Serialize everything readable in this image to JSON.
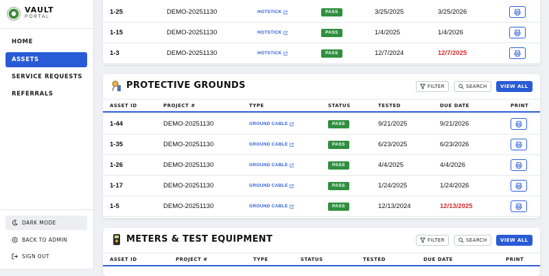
{
  "brand": {
    "title": "VAULT",
    "subtitle": "PORTAL"
  },
  "nav": {
    "items": [
      "HOME",
      "ASSETS",
      "SERVICE REQUESTS",
      "REFERRALS"
    ],
    "active": 1
  },
  "bottom": {
    "dark_mode": "DARK MODE",
    "back": "BACK TO ADMIN",
    "signout": "SIGN OUT"
  },
  "buttons": {
    "filter": "FILTER",
    "search": "SEARCH",
    "view_all": "VIEW ALL"
  },
  "hotsticks": {
    "rows": [
      {
        "id": "1-25",
        "project": "DEMO-20251130",
        "type": "HOTSTICK",
        "status": "PASS",
        "tested": "3/25/2025",
        "due": "3/25/2026",
        "overdue": false
      },
      {
        "id": "1-15",
        "project": "DEMO-20251130",
        "type": "HOTSTICK",
        "status": "PASS",
        "tested": "1/4/2025",
        "due": "1/4/2026",
        "overdue": false
      },
      {
        "id": "1-3",
        "project": "DEMO-20251130",
        "type": "HOTSTICK",
        "status": "PASS",
        "tested": "12/7/2024",
        "due": "12/7/2025",
        "overdue": true
      }
    ]
  },
  "grounds": {
    "title": "PROTECTIVE GROUNDS",
    "columns": [
      "ASSET ID",
      "PROJECT #",
      "TYPE",
      "STATUS",
      "TESTED",
      "DUE DATE",
      "PRINT"
    ],
    "rows": [
      {
        "id": "1-44",
        "project": "DEMO-20251130",
        "type": "GROUND CABLE",
        "status": "PASS",
        "tested": "9/21/2025",
        "due": "9/21/2026",
        "overdue": false
      },
      {
        "id": "1-35",
        "project": "DEMO-20251130",
        "type": "GROUND CABLE",
        "status": "PASS",
        "tested": "6/23/2025",
        "due": "6/23/2026",
        "overdue": false
      },
      {
        "id": "1-26",
        "project": "DEMO-20251130",
        "type": "GROUND CABLE",
        "status": "PASS",
        "tested": "4/4/2025",
        "due": "4/4/2026",
        "overdue": false
      },
      {
        "id": "1-17",
        "project": "DEMO-20251130",
        "type": "GROUND CABLE",
        "status": "PASS",
        "tested": "1/24/2025",
        "due": "1/24/2026",
        "overdue": false
      },
      {
        "id": "1-5",
        "project": "DEMO-20251130",
        "type": "GROUND CABLE",
        "status": "PASS",
        "tested": "12/13/2024",
        "due": "12/13/2025",
        "overdue": true
      }
    ]
  },
  "meters": {
    "title": "METERS & TEST EQUIPMENT",
    "columns": [
      "ASSET ID",
      "PROJECT #",
      "TYPE",
      "STATUS",
      "TESTED",
      "DUE DATE",
      "PRINT"
    ]
  },
  "colors": {
    "accent": "#2a5bd7",
    "pass": "#2f8f3e",
    "overdue": "#d32b2b"
  }
}
